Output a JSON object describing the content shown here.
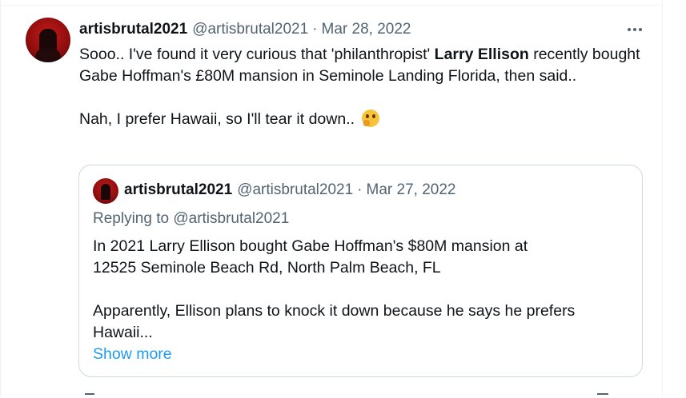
{
  "tweet": {
    "author_name": "artisbrutal2021",
    "author_handle": "@artisbrutal2021",
    "separator": "·",
    "date": "Mar 28, 2022",
    "line1_pre": "Sooo.. I've found it very curious that 'philanthropist' ",
    "line1_bold": "Larry Ellison",
    "line1_post": " recently bought Gabe Hoffman's £80M mansion in Seminole Landing Florida, then said..",
    "line2": "Nah, I prefer Hawaii, so I'll tear it down.. ",
    "emoji": "thinking-face-emoji"
  },
  "quoted": {
    "author_name": "artisbrutal2021",
    "author_handle": "@artisbrutal2021",
    "separator": "·",
    "date": "Mar 27, 2022",
    "replying_to": "Replying to @artisbrutal2021",
    "para1_line1": "In 2021 Larry Ellison bought Gabe Hoffman's $80M mansion at",
    "para1_line2": "12525 Seminole Beach Rd, North Palm Beach, FL",
    "para2_line1": "Apparently, Ellison plans to knock it down because he says he prefers",
    "para2_line2": "Hawaii...",
    "show_more": "Show more"
  },
  "colors": {
    "text": "#0f1419",
    "secondary": "#536471",
    "link": "#1d9bf0",
    "border": "#cfd9de"
  }
}
